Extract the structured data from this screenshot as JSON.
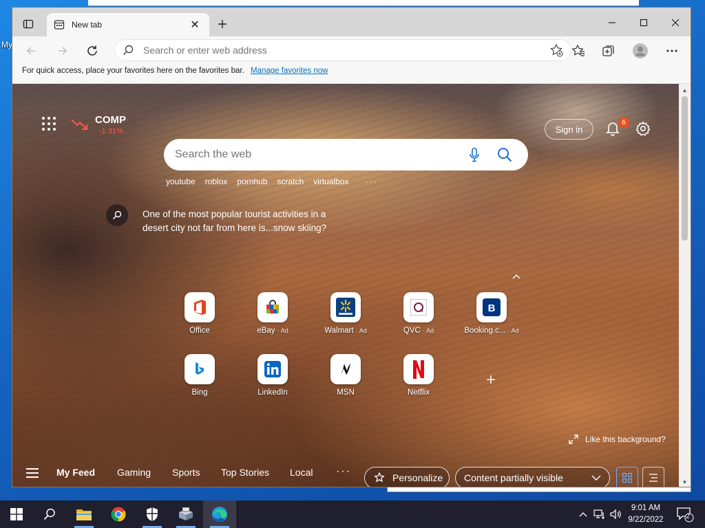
{
  "desktop": {
    "icon_label": "My"
  },
  "browser": {
    "tab_title": "New tab",
    "address_placeholder": "Search or enter web address",
    "favorites_bar": {
      "message": "For quick access, place your favorites here on the favorites bar.",
      "link": "Manage favorites now"
    }
  },
  "newtab": {
    "stock": {
      "symbol": "COMP",
      "change": "-1.31%"
    },
    "sign_in": "Sign in",
    "notification_count": "6",
    "search_placeholder": "Search the web",
    "trending": [
      "youtube",
      "roblox",
      "pornhub",
      "scratch",
      "virtualbox"
    ],
    "trending_more": "···",
    "fact": "One of the most popular tourist activities in a desert city not far from here is...snow skiing?",
    "quick_links_row1": [
      {
        "label": "Office",
        "ad": "",
        "icon": "office-icon"
      },
      {
        "label": "eBay",
        "ad": "· Ad",
        "icon": "ebay-icon"
      },
      {
        "label": "Walmart",
        "ad": "· Ad",
        "icon": "walmart-icon"
      },
      {
        "label": "QVC",
        "ad": "· Ad",
        "icon": "qvc-icon"
      },
      {
        "label": "Booking.c...",
        "ad": "· Ad",
        "icon": "booking-icon"
      }
    ],
    "quick_links_row2": [
      {
        "label": "Bing",
        "icon": "bing-icon"
      },
      {
        "label": "LinkedIn",
        "icon": "linkedin-icon"
      },
      {
        "label": "MSN",
        "icon": "msn-icon"
      },
      {
        "label": "Netflix",
        "icon": "netflix-icon"
      }
    ],
    "add_link": "+",
    "like_background": "Like this background?",
    "feed_tabs": [
      "My Feed",
      "Gaming",
      "Sports",
      "Top Stories",
      "Local"
    ],
    "feed_more": "···",
    "personalize": "Personalize",
    "content_visibility": "Content partially visible"
  },
  "taskbar": {
    "time": "9:01 AM",
    "date": "9/22/2022",
    "notification_count": "2"
  },
  "colors": {
    "accent": "#0078d4",
    "stock_down": "#ff5a4a",
    "badge": "#e8501e"
  }
}
